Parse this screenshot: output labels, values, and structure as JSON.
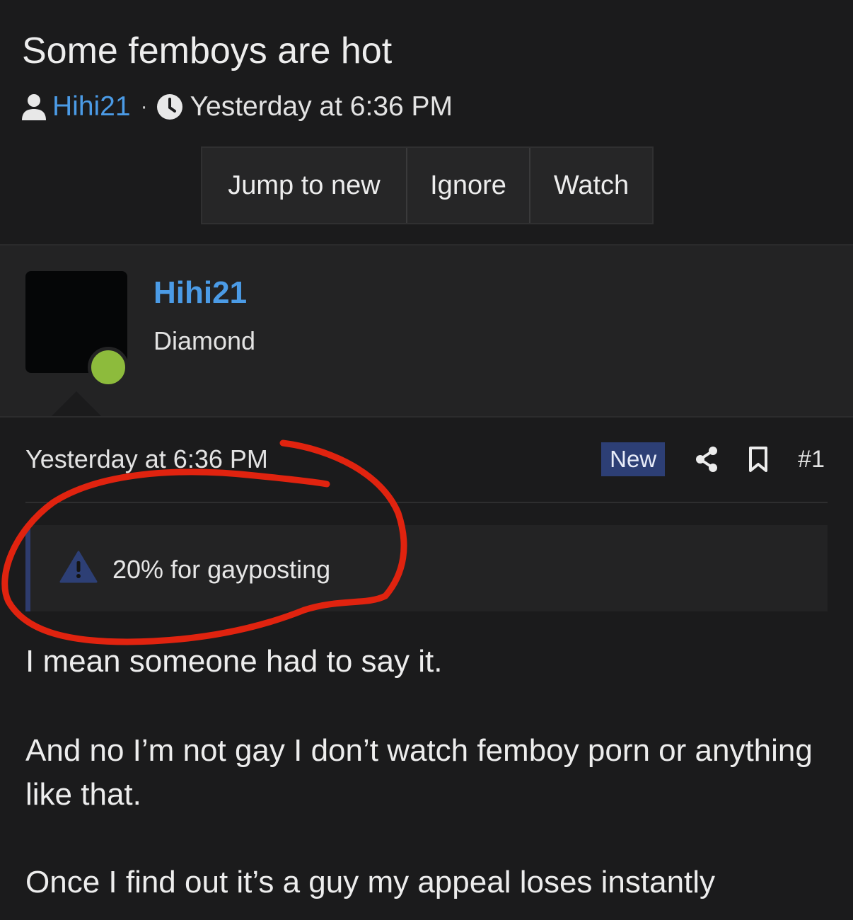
{
  "thread": {
    "title": "Some femboys are hot",
    "author": "Hihi21",
    "separator": "·",
    "date": "Yesterday at 6:36 PM",
    "buttons": {
      "jump": "Jump to new",
      "ignore": "Ignore",
      "watch": "Watch"
    }
  },
  "post": {
    "username": "Hihi21",
    "user_title": "Diamond",
    "online": true,
    "date": "Yesterday at 6:36 PM",
    "badge": "New",
    "number": "#1",
    "warning": "20% for gayposting",
    "paragraphs": [
      "I mean someone had to say it.",
      "And no I’m not gay I don’t watch femboy porn or anything like that.",
      "Once I find out it’s a guy my appeal loses instantly"
    ]
  },
  "colors": {
    "background": "#1b1b1c",
    "panel": "#232324",
    "link": "#4b9be6",
    "online": "#8dbb3c",
    "badge": "#2d3f75",
    "annotation": "#e0230f"
  },
  "icons": [
    "user-icon",
    "clock-icon",
    "share-icon",
    "bookmark-icon",
    "warning-icon"
  ]
}
